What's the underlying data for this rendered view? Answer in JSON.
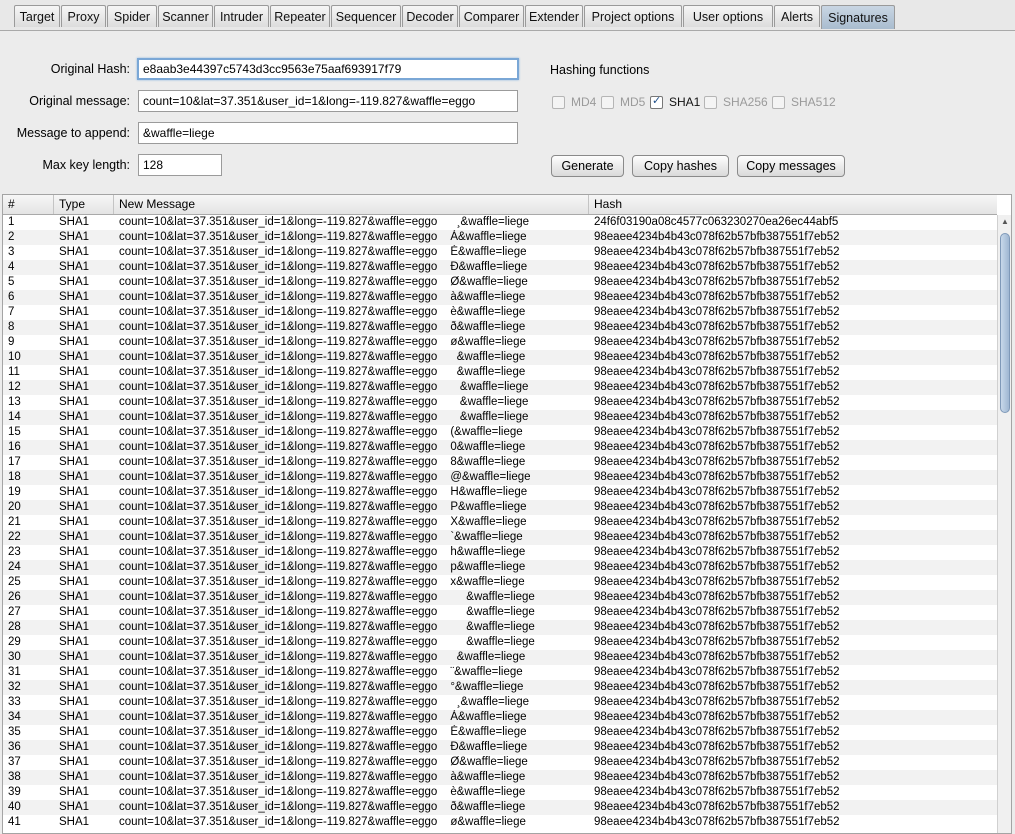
{
  "tabs": [
    "Target",
    "Proxy",
    "Spider",
    "Scanner",
    "Intruder",
    "Repeater",
    "Sequencer",
    "Decoder",
    "Comparer",
    "Extender",
    "Project options",
    "User options",
    "Alerts",
    "Signatures"
  ],
  "active_tab": "Signatures",
  "form": {
    "original_hash_label": "Original Hash:",
    "original_hash_value": "e8aab3e44397c5743d3cc9563e75aaf693917f79",
    "original_message_label": "Original message:",
    "original_message_value": "count=10&lat=37.351&user_id=1&long=-119.827&waffle=eggo",
    "append_label": "Message to append:",
    "append_value": "&waffle=liege",
    "max_key_label": "Max key length:",
    "max_key_value": "128"
  },
  "hashing": {
    "title": "Hashing functions",
    "options": [
      {
        "label": "MD4",
        "checked": false
      },
      {
        "label": "MD5",
        "checked": false
      },
      {
        "label": "SHA1",
        "checked": true
      },
      {
        "label": "SHA256",
        "checked": false
      },
      {
        "label": "SHA512",
        "checked": false
      }
    ]
  },
  "buttons": {
    "generate": "Generate",
    "copy_hashes": "Copy hashes",
    "copy_messages": "Copy messages"
  },
  "table": {
    "columns": [
      "#",
      "Type",
      "New Message",
      "Hash"
    ],
    "message_prefix": "count=10&lat=37.351&user_id=1&long=-119.827&waffle=eggo",
    "rows": [
      [
        "1",
        "SHA1",
        "  ¸&waffle=liege",
        "24f6f03190a08c4577c063230270ea26ec44abf5"
      ],
      [
        "2",
        "SHA1",
        "À&waffle=liege",
        "98eaee4234b4b43c078f62b57bfb387551f7eb52"
      ],
      [
        "3",
        "SHA1",
        "È&waffle=liege",
        "98eaee4234b4b43c078f62b57bfb387551f7eb52"
      ],
      [
        "4",
        "SHA1",
        "Ð&waffle=liege",
        "98eaee4234b4b43c078f62b57bfb387551f7eb52"
      ],
      [
        "5",
        "SHA1",
        "Ø&waffle=liege",
        "98eaee4234b4b43c078f62b57bfb387551f7eb52"
      ],
      [
        "6",
        "SHA1",
        "à&waffle=liege",
        "98eaee4234b4b43c078f62b57bfb387551f7eb52"
      ],
      [
        "7",
        "SHA1",
        "è&waffle=liege",
        "98eaee4234b4b43c078f62b57bfb387551f7eb52"
      ],
      [
        "8",
        "SHA1",
        "ð&waffle=liege",
        "98eaee4234b4b43c078f62b57bfb387551f7eb52"
      ],
      [
        "9",
        "SHA1",
        "ø&waffle=liege",
        "98eaee4234b4b43c078f62b57bfb387551f7eb52"
      ],
      [
        "10",
        "SHA1",
        "  &waffle=liege",
        "98eaee4234b4b43c078f62b57bfb387551f7eb52"
      ],
      [
        "11",
        "SHA1",
        "  &waffle=liege",
        "98eaee4234b4b43c078f62b57bfb387551f7eb52"
      ],
      [
        "12",
        "SHA1",
        "   &waffle=liege",
        "98eaee4234b4b43c078f62b57bfb387551f7eb52"
      ],
      [
        "13",
        "SHA1",
        "   &waffle=liege",
        "98eaee4234b4b43c078f62b57bfb387551f7eb52"
      ],
      [
        "14",
        "SHA1",
        "   &waffle=liege",
        "98eaee4234b4b43c078f62b57bfb387551f7eb52"
      ],
      [
        "15",
        "SHA1",
        "(&waffle=liege",
        "98eaee4234b4b43c078f62b57bfb387551f7eb52"
      ],
      [
        "16",
        "SHA1",
        "0&waffle=liege",
        "98eaee4234b4b43c078f62b57bfb387551f7eb52"
      ],
      [
        "17",
        "SHA1",
        "8&waffle=liege",
        "98eaee4234b4b43c078f62b57bfb387551f7eb52"
      ],
      [
        "18",
        "SHA1",
        "@&waffle=liege",
        "98eaee4234b4b43c078f62b57bfb387551f7eb52"
      ],
      [
        "19",
        "SHA1",
        "H&waffle=liege",
        "98eaee4234b4b43c078f62b57bfb387551f7eb52"
      ],
      [
        "20",
        "SHA1",
        "P&waffle=liege",
        "98eaee4234b4b43c078f62b57bfb387551f7eb52"
      ],
      [
        "21",
        "SHA1",
        "X&waffle=liege",
        "98eaee4234b4b43c078f62b57bfb387551f7eb52"
      ],
      [
        "22",
        "SHA1",
        "`&waffle=liege",
        "98eaee4234b4b43c078f62b57bfb387551f7eb52"
      ],
      [
        "23",
        "SHA1",
        "h&waffle=liege",
        "98eaee4234b4b43c078f62b57bfb387551f7eb52"
      ],
      [
        "24",
        "SHA1",
        "p&waffle=liege",
        "98eaee4234b4b43c078f62b57bfb387551f7eb52"
      ],
      [
        "25",
        "SHA1",
        "x&waffle=liege",
        "98eaee4234b4b43c078f62b57bfb387551f7eb52"
      ],
      [
        "26",
        "SHA1",
        "     &waffle=liege",
        "98eaee4234b4b43c078f62b57bfb387551f7eb52"
      ],
      [
        "27",
        "SHA1",
        "     &waffle=liege",
        "98eaee4234b4b43c078f62b57bfb387551f7eb52"
      ],
      [
        "28",
        "SHA1",
        "     &waffle=liege",
        "98eaee4234b4b43c078f62b57bfb387551f7eb52"
      ],
      [
        "29",
        "SHA1",
        "     &waffle=liege",
        "98eaee4234b4b43c078f62b57bfb387551f7eb52"
      ],
      [
        "30",
        "SHA1",
        "  &waffle=liege",
        "98eaee4234b4b43c078f62b57bfb387551f7eb52"
      ],
      [
        "31",
        "SHA1",
        "¨&waffle=liege",
        "98eaee4234b4b43c078f62b57bfb387551f7eb52"
      ],
      [
        "32",
        "SHA1",
        "°&waffle=liege",
        "98eaee4234b4b43c078f62b57bfb387551f7eb52"
      ],
      [
        "33",
        "SHA1",
        "  ¸&waffle=liege",
        "98eaee4234b4b43c078f62b57bfb387551f7eb52"
      ],
      [
        "34",
        "SHA1",
        "À&waffle=liege",
        "98eaee4234b4b43c078f62b57bfb387551f7eb52"
      ],
      [
        "35",
        "SHA1",
        "È&waffle=liege",
        "98eaee4234b4b43c078f62b57bfb387551f7eb52"
      ],
      [
        "36",
        "SHA1",
        "Ð&waffle=liege",
        "98eaee4234b4b43c078f62b57bfb387551f7eb52"
      ],
      [
        "37",
        "SHA1",
        "Ø&waffle=liege",
        "98eaee4234b4b43c078f62b57bfb387551f7eb52"
      ],
      [
        "38",
        "SHA1",
        "à&waffle=liege",
        "98eaee4234b4b43c078f62b57bfb387551f7eb52"
      ],
      [
        "39",
        "SHA1",
        "è&waffle=liege",
        "98eaee4234b4b43c078f62b57bfb387551f7eb52"
      ],
      [
        "40",
        "SHA1",
        "ð&waffle=liege",
        "98eaee4234b4b43c078f62b57bfb387551f7eb52"
      ],
      [
        "41",
        "SHA1",
        "ø&waffle=liege",
        "98eaee4234b4b43c078f62b57bfb387551f7eb52"
      ]
    ]
  }
}
